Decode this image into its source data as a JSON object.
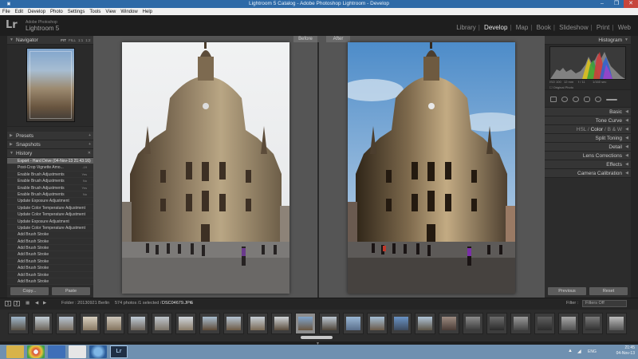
{
  "window": {
    "title": "Lightroom 5 Catalog - Adobe Photoshop Lightroom - Develop",
    "minimize": "‒",
    "restore": "❐",
    "close": "✕"
  },
  "menu": [
    "File",
    "Edit",
    "Develop",
    "Photo",
    "Settings",
    "Tools",
    "View",
    "Window",
    "Help"
  ],
  "identity": {
    "logo": "Lr",
    "vendor": "Adobe Photoshop",
    "product": "Lightroom 5"
  },
  "modules": [
    "Library",
    "Develop",
    "Map",
    "Book",
    "Slideshow",
    "Print",
    "Web"
  ],
  "active_module": "Develop",
  "left_panel": {
    "navigator": {
      "label": "Navigator",
      "zoom": [
        "FIT",
        "FILL",
        "1:1",
        "1:2"
      ],
      "active_zoom": "FIT"
    },
    "presets": "Presets",
    "snapshots": "Snapshots",
    "history": {
      "label": "History",
      "items": [
        {
          "label": "Export - Hard Drive (04-Nov-13 21:43:16)",
          "value": "",
          "selected": true
        },
        {
          "label": "Post-Crop Vignette Amo...",
          "value": "-19",
          "selected": false
        },
        {
          "label": "Enable Brush Adjustments",
          "value": "Yes",
          "selected": false
        },
        {
          "label": "Enable Brush Adjustments",
          "value": "No",
          "selected": false
        },
        {
          "label": "Enable Brush Adjustments",
          "value": "Yes",
          "selected": false
        },
        {
          "label": "Enable Brush Adjustments",
          "value": "No",
          "selected": false
        },
        {
          "label": "Update Exposure Adjustment",
          "value": "",
          "selected": false
        },
        {
          "label": "Update Color Temperature Adjustment",
          "value": "",
          "selected": false
        },
        {
          "label": "Update Color Temperature Adjustment",
          "value": "",
          "selected": false
        },
        {
          "label": "Update Exposure Adjustment",
          "value": "",
          "selected": false
        },
        {
          "label": "Update Color Temperature Adjustment",
          "value": "",
          "selected": false
        },
        {
          "label": "Add Brush Stroke",
          "value": "",
          "selected": false
        },
        {
          "label": "Add Brush Stroke",
          "value": "",
          "selected": false
        },
        {
          "label": "Add Brush Stroke",
          "value": "",
          "selected": false
        },
        {
          "label": "Add Brush Stroke",
          "value": "",
          "selected": false
        },
        {
          "label": "Add Brush Stroke",
          "value": "",
          "selected": false
        },
        {
          "label": "Add Brush Stroke",
          "value": "",
          "selected": false
        },
        {
          "label": "Add Brush Stroke",
          "value": "",
          "selected": false
        },
        {
          "label": "Add Brush Stroke",
          "value": "",
          "selected": false
        }
      ]
    },
    "copy_button": "Copy...",
    "paste_button": "Paste"
  },
  "right_panel": {
    "histogram": {
      "label": "Histogram",
      "meta": [
        "ISO 100",
        "12 mm",
        "f / 11",
        "1/160 sec"
      ],
      "original_photo": "Original Photo"
    },
    "sections": [
      "Basic",
      "Tone Curve"
    ],
    "hsl": {
      "hsl": "HSL",
      "color": "Color",
      "bw": "B & W"
    },
    "sections2": [
      "Split Toning",
      "Detail",
      "Lens Corrections",
      "Effects",
      "Camera Calibration"
    ],
    "previous_button": "Previous",
    "reset_button": "Reset"
  },
  "workspace": {
    "before_label": "Before",
    "after_label": "After"
  },
  "filmstrip_bar": {
    "num1": "1",
    "num2": "2",
    "folder": "Folder : 20130921 Berlin",
    "count": "574 photos /1 selected /",
    "filename": "DSC04679.JPG",
    "filter_label": "Filter :",
    "filter_value": "Filters Off"
  },
  "taskbar": {
    "time": "21:45",
    "date": "04-Nov-13",
    "lang": "ENG"
  },
  "colors": {
    "panel": "#2c2c2c",
    "workspace": "#555555",
    "accent_taskbar": "#6f90b0"
  }
}
